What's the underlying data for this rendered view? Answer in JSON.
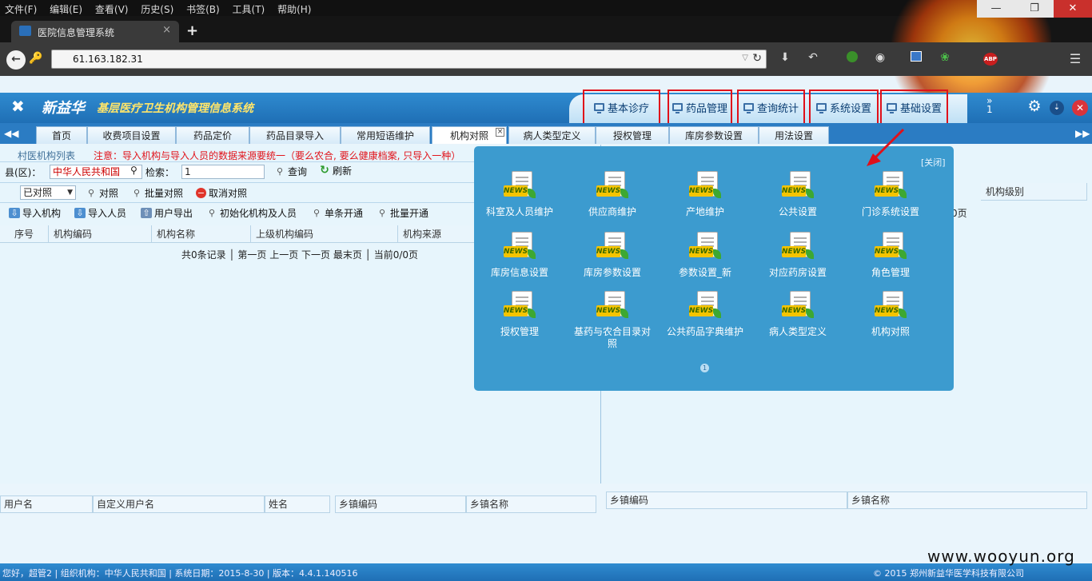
{
  "browser": {
    "menu": [
      "文件(F)",
      "编辑(E)",
      "查看(V)",
      "历史(S)",
      "书签(B)",
      "工具(T)",
      "帮助(H)"
    ],
    "tab_title": "医院信息管理系统",
    "tab_close": "×",
    "new_tab": "+",
    "url": "61.163.182.31",
    "window_buttons": [
      "—",
      "❐",
      "✕"
    ],
    "extension_labels": [
      "ABP"
    ]
  },
  "app": {
    "brand": "新益华",
    "system_title": "基层医疗卫生机构管理信息系统",
    "modules": [
      "基本诊疗",
      "药品管理",
      "查询统计",
      "系统设置",
      "基础设置"
    ],
    "more_label": "1"
  },
  "page_tabs": [
    "首页",
    "收费项目设置",
    "药品定价",
    "药品目录导入",
    "常用短语维护",
    "机构对照",
    "病人类型定义",
    "授权管理",
    "库房参数设置",
    "用法设置"
  ],
  "active_tab": "机构对照",
  "left": {
    "list_title": "村医机构列表",
    "notice": "注意：导入机构与导入人员的数据来源要统一（要么农合, 要么健康档案, 只导入一种）",
    "county_label": "县(区)：",
    "county_value": "中华人民共和国",
    "search_label": "检索：",
    "search_value": "1",
    "query_btn": "查询",
    "refresh_btn": "刷新",
    "status_select": "已对照",
    "map_btn": "对照",
    "batch_map_btn": "批量对照",
    "cancel_map_btn": "取消对照",
    "toolbar": [
      "导入机构",
      "导入人员",
      "用户导出",
      "初始化机构及人员",
      "单条开通",
      "批量开通"
    ],
    "columns": [
      "序号",
      "机构编码",
      "机构名称",
      "上级机构编码",
      "机构来源"
    ],
    "paging": "共0条记录 │ 第一页  上一页  下一页  最末页 │ 当前0/0页"
  },
  "right": {
    "column_partial": "机构级别",
    "paging_partial": "0页"
  },
  "bottom": {
    "user_columns": [
      "用户名",
      "自定义用户名",
      "姓名"
    ],
    "town_columns": [
      "乡镇编码",
      "乡镇名称"
    ],
    "right_columns": [
      "乡镇编码",
      "乡镇名称"
    ]
  },
  "popup": {
    "close_label": "[关闭]",
    "items": [
      "科室及人员维护",
      "供应商维护",
      "产地维护",
      "公共设置",
      "门诊系统设置",
      "库房信息设置",
      "库房参数设置",
      "参数设置_新",
      "对应药房设置",
      "角色管理",
      "授权管理",
      "基药与农合目录对照",
      "公共药品字典维护",
      "病人类型定义",
      "机构对照"
    ],
    "page_indicator": "1",
    "icon_tag": "NEWS"
  },
  "statusbar": {
    "left": "您好，超管2 | 组织机构：中华人民共和国 | 系统日期：2015-8-30 | 版本：4.4.1.140516",
    "right": "© 2015 郑州新益华医学科技有限公司"
  },
  "watermark": "www.wooyun.org",
  "colors": {
    "header_blue": "#1f6fb5",
    "popup_blue": "#3c9bcf",
    "highlight_red": "#e0101a",
    "notice_red": "#e1141b"
  }
}
